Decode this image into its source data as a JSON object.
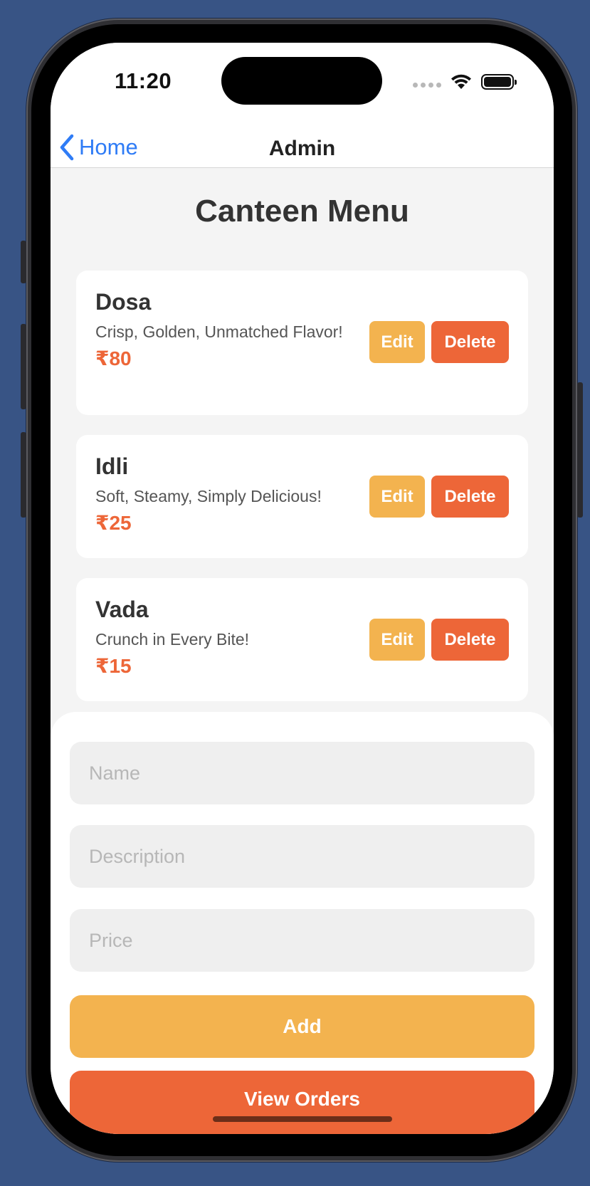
{
  "status_bar": {
    "time": "11:20"
  },
  "nav": {
    "back_label": "Home",
    "title": "Admin"
  },
  "page_title": "Canteen Menu",
  "menu_items": [
    {
      "name": "Dosa",
      "description": "Crisp, Golden, Unmatched Flavor!",
      "price": "₹80"
    },
    {
      "name": "Idli",
      "description": "Soft, Steamy, Simply Delicious!",
      "price": "₹25"
    },
    {
      "name": "Vada",
      "description": "Crunch in Every Bite!",
      "price": "₹15"
    }
  ],
  "actions": {
    "edit_label": "Edit",
    "delete_label": "Delete"
  },
  "form": {
    "name_placeholder": "Name",
    "description_placeholder": "Description",
    "price_placeholder": "Price",
    "name_value": "",
    "description_value": "",
    "price_value": ""
  },
  "buttons": {
    "add_label": "Add",
    "view_orders_label": "View Orders"
  },
  "colors": {
    "background": "#385485",
    "accent_blue": "#2f7cf6",
    "edit_yellow": "#f3b34f",
    "delete_orange": "#ed6638",
    "price_orange": "#ed6638"
  }
}
